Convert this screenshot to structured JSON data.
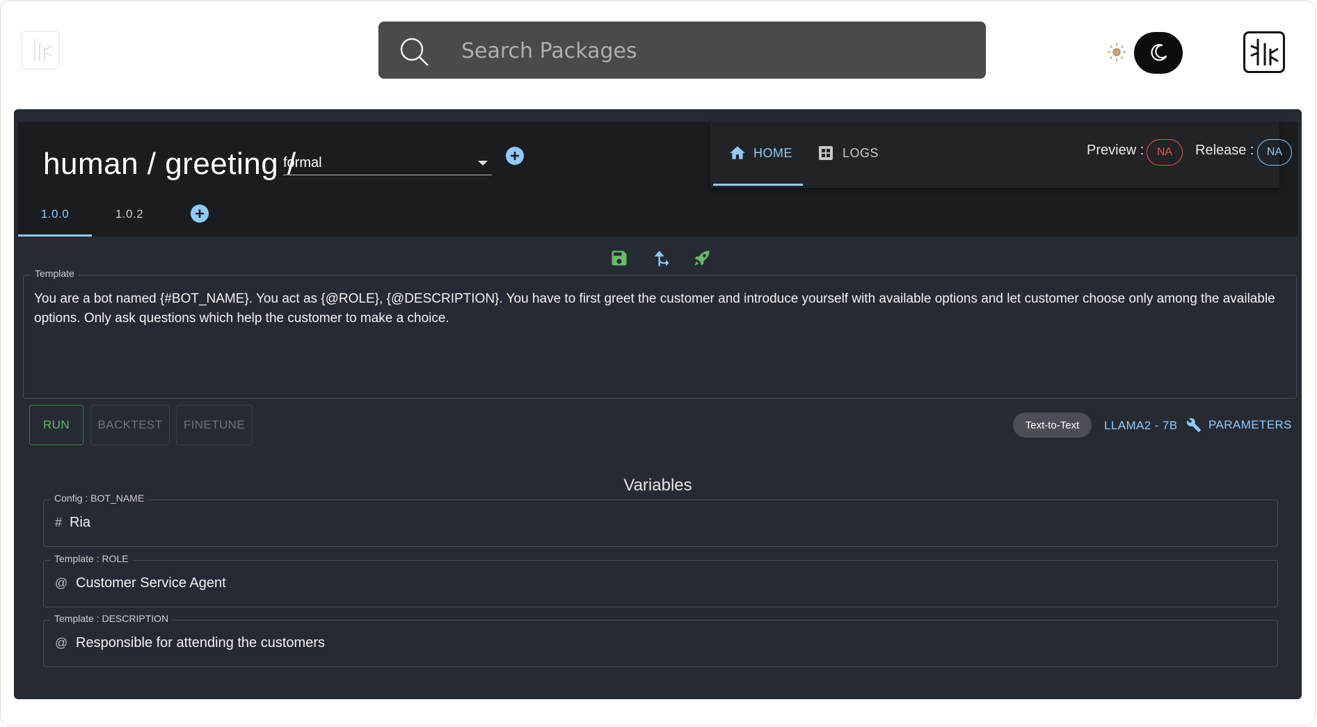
{
  "topbar": {
    "search_placeholder": "Search Packages",
    "icons": {
      "search": "search-icon",
      "sun": "sun-icon",
      "moon": "moon-icon",
      "logo": "bamboo-logo-icon"
    }
  },
  "header": {
    "breadcrumb": "human / greeting /",
    "variant_selected": "formal",
    "nav": {
      "home_label": "HOME",
      "logs_label": "LOGS"
    },
    "preview_label": "Preview :",
    "preview_value": "NA",
    "release_label": "Release :",
    "release_value": "NA",
    "versions": [
      "1.0.0",
      "1.0.2"
    ],
    "active_version": "1.0.0"
  },
  "toolbar": {
    "icons": [
      "save-icon",
      "fork-icon",
      "rocket-icon"
    ]
  },
  "template": {
    "label": "Template",
    "text": "You are a bot named {#BOT_NAME}. You act as {@ROLE}, {@DESCRIPTION}. You have to first greet the customer and introduce yourself with available options and let customer choose only among the available options. Only ask questions which help the customer to make a choice."
  },
  "actions": {
    "run": "RUN",
    "backtest": "BACKTEST",
    "finetune": "FINETUNE",
    "mode_chip": "Text-to-Text",
    "model": "LLAMA2 - 7B",
    "parameters": "PARAMETERS"
  },
  "variables": {
    "title": "Variables",
    "items": [
      {
        "label": "Config : BOT_NAME",
        "prefix": "#",
        "value": "Ria"
      },
      {
        "label": "Template : ROLE",
        "prefix": "@",
        "value": "Customer Service Agent"
      },
      {
        "label": "Template : DESCRIPTION",
        "prefix": "@",
        "value": "Responsible for attending the customers"
      }
    ]
  },
  "colors": {
    "accent": "#90caf9",
    "success": "#66bb6a",
    "danger": "#ef5350",
    "panel": "#262a33",
    "header": "#1b1c1f"
  }
}
